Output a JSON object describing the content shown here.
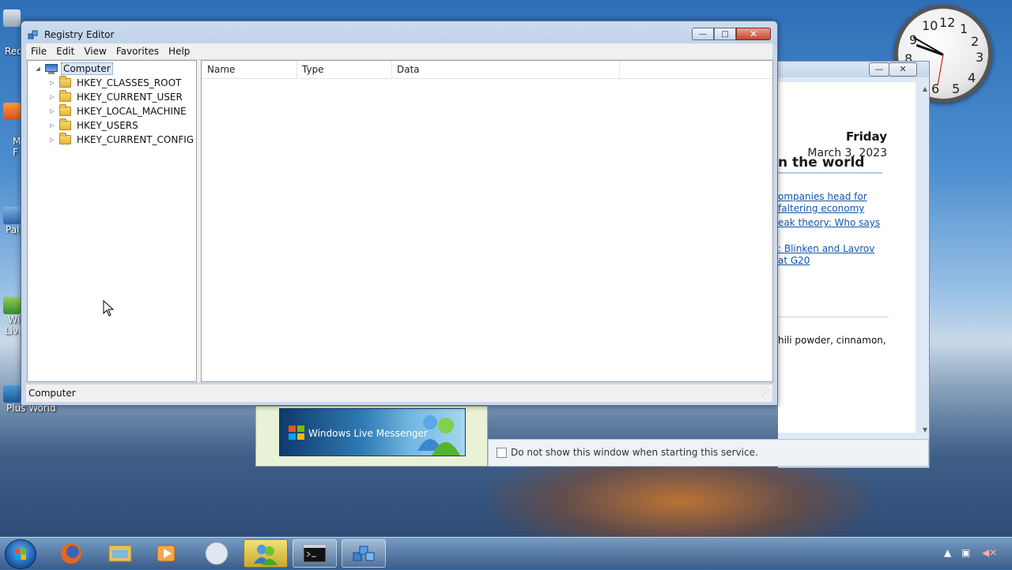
{
  "window": {
    "title": "Registry Editor",
    "menus": [
      "File",
      "Edit",
      "View",
      "Favorites",
      "Help"
    ],
    "tree": {
      "root": "Computer",
      "items": [
        "HKEY_CLASSES_ROOT",
        "HKEY_CURRENT_USER",
        "HKEY_LOCAL_MACHINE",
        "HKEY_USERS",
        "HKEY_CURRENT_CONFIG"
      ]
    },
    "columns": [
      "Name",
      "Type",
      "Data"
    ],
    "status": "Computer",
    "caption": {
      "minimize": "—",
      "maximize": "□",
      "close": "✕"
    }
  },
  "background_window": {
    "day": "Friday",
    "date": "March 3, 2023",
    "heading": "n the world",
    "links": [
      "ompanies head for",
      " faltering economy",
      "eak theory: Who says",
      ": Blinken and Lavrov",
      " at G20"
    ],
    "snippet": "hili powder, cinnamon,",
    "messenger": "Windows Live Messenger",
    "checkbox_label": "Do not show this window when starting this service."
  },
  "clock": {
    "numbers": [
      "12",
      "1",
      "2",
      "3",
      "4",
      "5",
      "6",
      "7",
      "8",
      "9",
      "10",
      "11"
    ]
  },
  "desktop": {
    "labels": [
      "Rec",
      "M",
      "F",
      "Pal",
      "Wi",
      "Live",
      "Plus World"
    ]
  },
  "colors": {
    "accent": "#2f6fb8",
    "close": "#c7452d",
    "link": "#1155aa"
  },
  "taskbar": {
    "icons": [
      "start-orb",
      "firefox-icon",
      "explorer-icon",
      "media-player-icon",
      "sphere-icon",
      "messenger-icon",
      "cmd-icon",
      "regedit-icon"
    ]
  }
}
